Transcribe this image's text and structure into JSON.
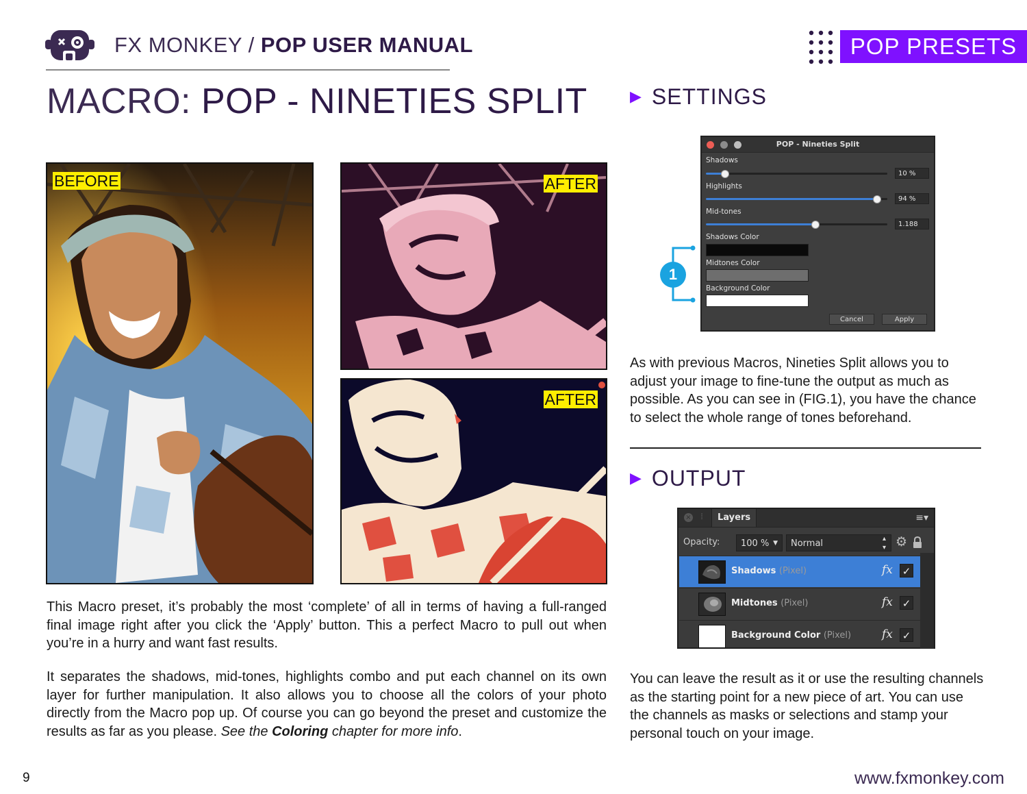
{
  "header": {
    "brand": "FX MONKEY",
    "separator": " / ",
    "manual": "POP USER MANUAL",
    "section_tab": "POP PRESETS",
    "logo_icon": "monkey-head-icon"
  },
  "title": {
    "prefix": "MACRO: ",
    "name": "POP - NINETIES SPLIT"
  },
  "photos": {
    "before_label": "BEFORE",
    "after_label_1": "AFTER",
    "after_label_2": "AFTER"
  },
  "body": {
    "para1": "This Macro preset, it’s probably the most ‘complete’ of all in terms of having a full-ranged final image right after you click the ‘Apply’ button. This a perfect Macro to pull out when you’re in a hurry and want fast results.",
    "para2_main": "It separates the shadows, mid-tones, highlights combo and put each channel on its own layer for further manipulation. It also allows you to choose all the colors of your photo directly from the Macro pop up. Of course you can go beyond the preset and customize the results as far as you please. ",
    "para2_see": "See the ",
    "para2_bold": "Coloring",
    "para2_end": " chapter for more info",
    "para2_period": "."
  },
  "settings": {
    "heading": "SETTINGS",
    "dialog": {
      "title": "POP - Nineties Split",
      "shadows_label": "Shadows",
      "shadows_value": "10 %",
      "shadows_level": 0.1,
      "highlights_label": "Highlights",
      "highlights_value": "94 %",
      "highlights_level": 0.94,
      "midtones_label": "Mid-tones",
      "midtones_value": "1.188",
      "midtones_level": 0.6,
      "shadows_color_label": "Shadows Color",
      "shadows_color": "#0a0a0a",
      "midtones_color_label": "Midtones Color",
      "midtones_color": "#6e6e6e",
      "background_color_label": "Background Color",
      "background_color": "#ffffff",
      "cancel": "Cancel",
      "apply": "Apply"
    },
    "callout_number": "1",
    "description": "As with previous Macros, Nineties Split allows you to adjust your image to fine-tune the output as much as possible. As you can see in (FIG.1), you have the chance to select the whole range of tones beforehand."
  },
  "output": {
    "heading": "OUTPUT",
    "panel": {
      "tab": "Layers",
      "opacity_label": "Opacity:",
      "opacity_value": "100 %",
      "blend_mode": "Normal",
      "layers": [
        {
          "name": "Shadows",
          "type": "(Pixel)",
          "fx": "fx",
          "check": "✓"
        },
        {
          "name": "Midtones",
          "type": "(Pixel)",
          "fx": "fx",
          "check": "✓"
        },
        {
          "name": "Background Color",
          "type": "(Pixel)",
          "fx": "fx",
          "check": "✓"
        }
      ]
    },
    "description": "You can leave the result as it or use the resulting channels as the starting point for a new piece of art. You can use the channels as masks or selections and stamp your personal touch on your image."
  },
  "footer": {
    "page_number": "9",
    "url": "www.fxmonkey.com"
  },
  "colors": {
    "accent": "#7f11ff",
    "title": "#2e1a47",
    "highlight_label": "#ffee00",
    "selected_layer": "#3d7fd6",
    "callout": "#1aa3e0"
  }
}
